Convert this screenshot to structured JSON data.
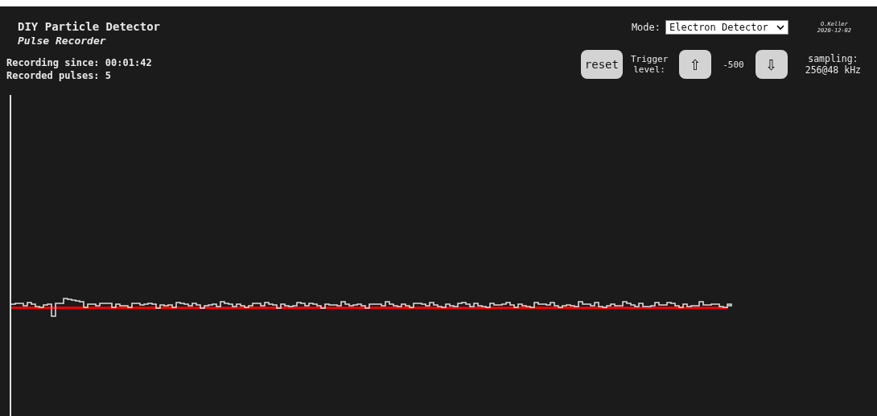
{
  "title": "DIY Particle Detector",
  "subtitle": "Pulse Recorder",
  "stats": [
    "Recording since: 00:01:42",
    "Recorded pulses: 5"
  ],
  "mode": {
    "label": "Mode:",
    "value": "Electron Detector"
  },
  "author": {
    "name": "O.Keller",
    "date": "2020-12-02"
  },
  "controls": {
    "reset": "reset",
    "trigger_label": [
      "Trigger",
      "level:"
    ],
    "up": "⇧",
    "trigger_value": "-500",
    "down": "⇩",
    "sampling": [
      "sampling:",
      "256@48 kHz"
    ]
  }
}
